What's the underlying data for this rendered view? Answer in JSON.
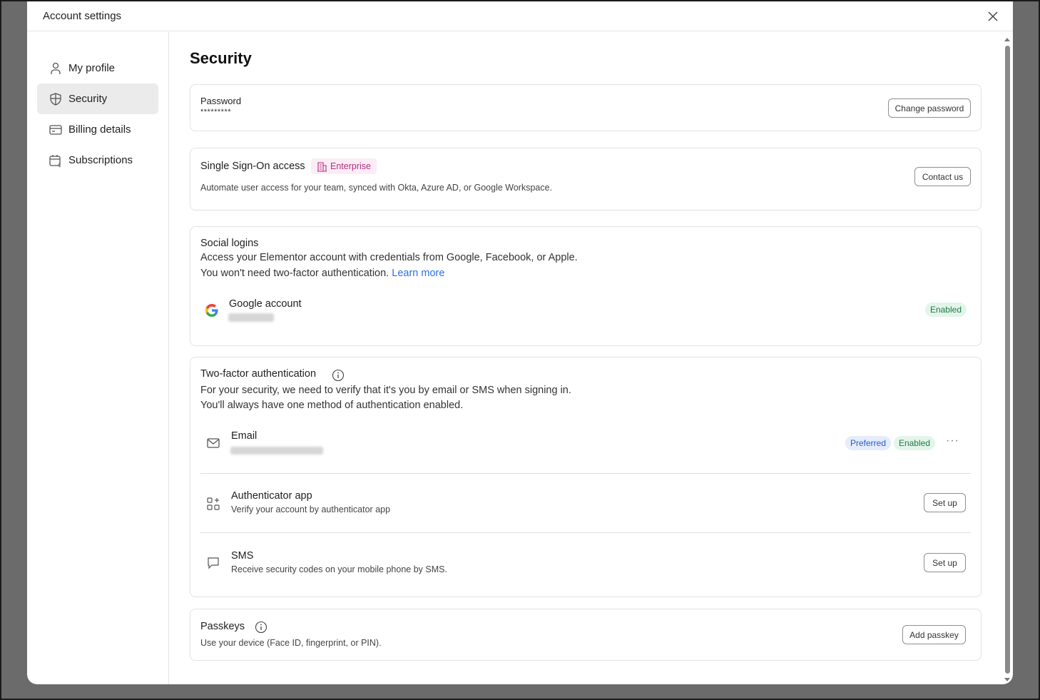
{
  "window": {
    "title": "Account settings"
  },
  "sidebar": {
    "items": [
      {
        "label": "My profile",
        "icon": "user-icon"
      },
      {
        "label": "Security",
        "icon": "shield-icon",
        "active": true
      },
      {
        "label": "Billing details",
        "icon": "credit-card-icon"
      },
      {
        "label": "Subscriptions",
        "icon": "calendar-dollar-icon"
      }
    ]
  },
  "main": {
    "title": "Security",
    "password": {
      "label": "Password",
      "value": "*********",
      "button": "Change password"
    },
    "sso": {
      "title": "Single Sign-On access",
      "badge": "Enterprise",
      "description": "Automate user access for your team, synced with Okta, Azure AD, or Google Workspace.",
      "button": "Contact us"
    },
    "social": {
      "title": "Social logins",
      "line1": "Access your Elementor account with credentials from Google, Facebook, or Apple.",
      "line2": "You won't need two-factor authentication.",
      "link": "Learn more",
      "google": {
        "name": "Google account",
        "status": "Enabled"
      }
    },
    "twofa": {
      "title": "Two-factor authentication",
      "line1": "For your security, we need to verify that it's you by email or SMS when signing in.",
      "line2": "You'll always have one method of authentication enabled.",
      "email": {
        "name": "Email",
        "preferred": "Preferred",
        "status": "Enabled",
        "more": "···"
      },
      "app": {
        "name": "Authenticator app",
        "desc": "Verify your account by authenticator app",
        "button": "Set up"
      },
      "sms": {
        "name": "SMS",
        "desc": "Receive security codes on your mobile phone by SMS.",
        "button": "Set up"
      }
    },
    "passkeys": {
      "title": "Passkeys",
      "desc": "Use your device (Face ID, fingerprint, or PIN).",
      "button": "Add passkey"
    }
  },
  "colors": {
    "accent_link": "#2f6fde",
    "enabled_bg": "#e3f5ea",
    "enabled_text": "#1e7a45",
    "preferred_bg": "#e5ecfb",
    "preferred_text": "#2a5bc2",
    "enterprise_bg": "#fcecf6",
    "enterprise_text": "#b0307f",
    "active_nav_bg": "#ebebeb"
  }
}
